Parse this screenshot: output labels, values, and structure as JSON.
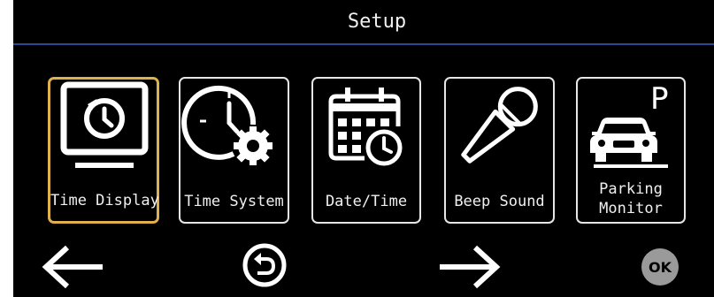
{
  "header": {
    "title": "Setup"
  },
  "tiles": [
    {
      "label": "Time Display",
      "icon": "monitor-clock-icon",
      "selected": true
    },
    {
      "label": "Time System",
      "icon": "clock-gear-icon",
      "selected": false
    },
    {
      "label": "Date/Time",
      "icon": "calendar-clock-icon",
      "selected": false
    },
    {
      "label": "Beep Sound",
      "icon": "microphone-icon",
      "selected": false
    },
    {
      "label_line1": "Parking",
      "label_line2": "Monitor",
      "icon": "parking-car-icon",
      "selected": false
    }
  ],
  "footer": {
    "back": "arrow-left-icon",
    "return": "return-icon",
    "next": "arrow-right-icon",
    "ok_label": "OK"
  },
  "colors": {
    "selected_border": "#e0b04d",
    "header_line": "#2a4a92",
    "background": "#000000"
  }
}
